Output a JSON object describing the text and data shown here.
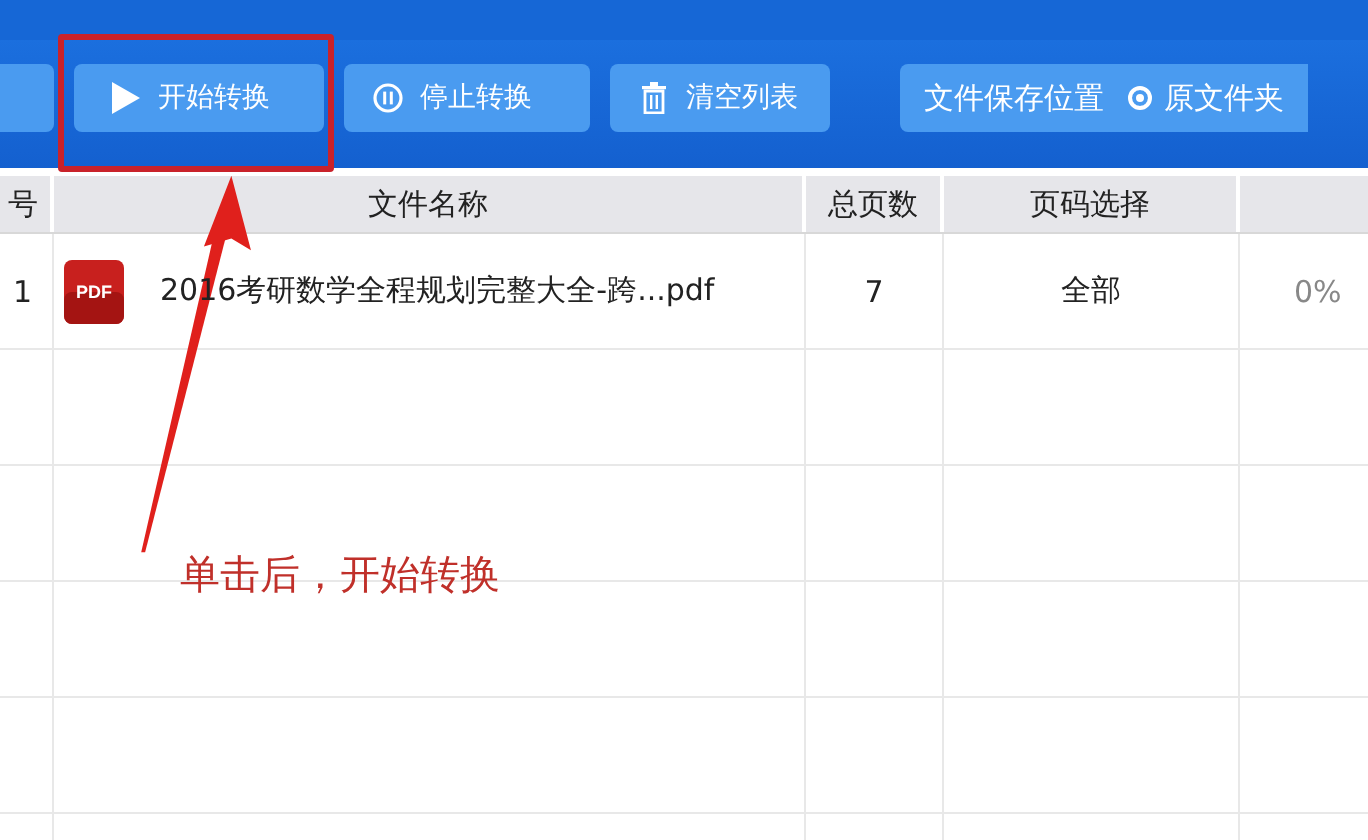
{
  "toolbar": {
    "buttons": [
      {
        "kind": "partial",
        "highlighted": false
      },
      {
        "kind": "start",
        "label": "开始转换",
        "highlighted": true
      },
      {
        "kind": "stop",
        "label": "停止转换",
        "highlighted": false
      },
      {
        "kind": "clear",
        "label": "清空列表",
        "highlighted": false
      }
    ],
    "save_location": {
      "label": "文件保存位置",
      "option": {
        "label": "原文件夹",
        "selected": true
      }
    }
  },
  "table": {
    "columns": [
      "号",
      "文件名称",
      "总页数",
      "页码选择"
    ],
    "rows": [
      {
        "index": "1",
        "kind": "pdf",
        "icon_label": "PDF",
        "name": "2016考研数学全程规划完整大全-跨...pdf",
        "pages": "7",
        "range": "全部",
        "progress": "0%"
      }
    ]
  },
  "annotation": {
    "text": "单击后，开始转换"
  }
}
